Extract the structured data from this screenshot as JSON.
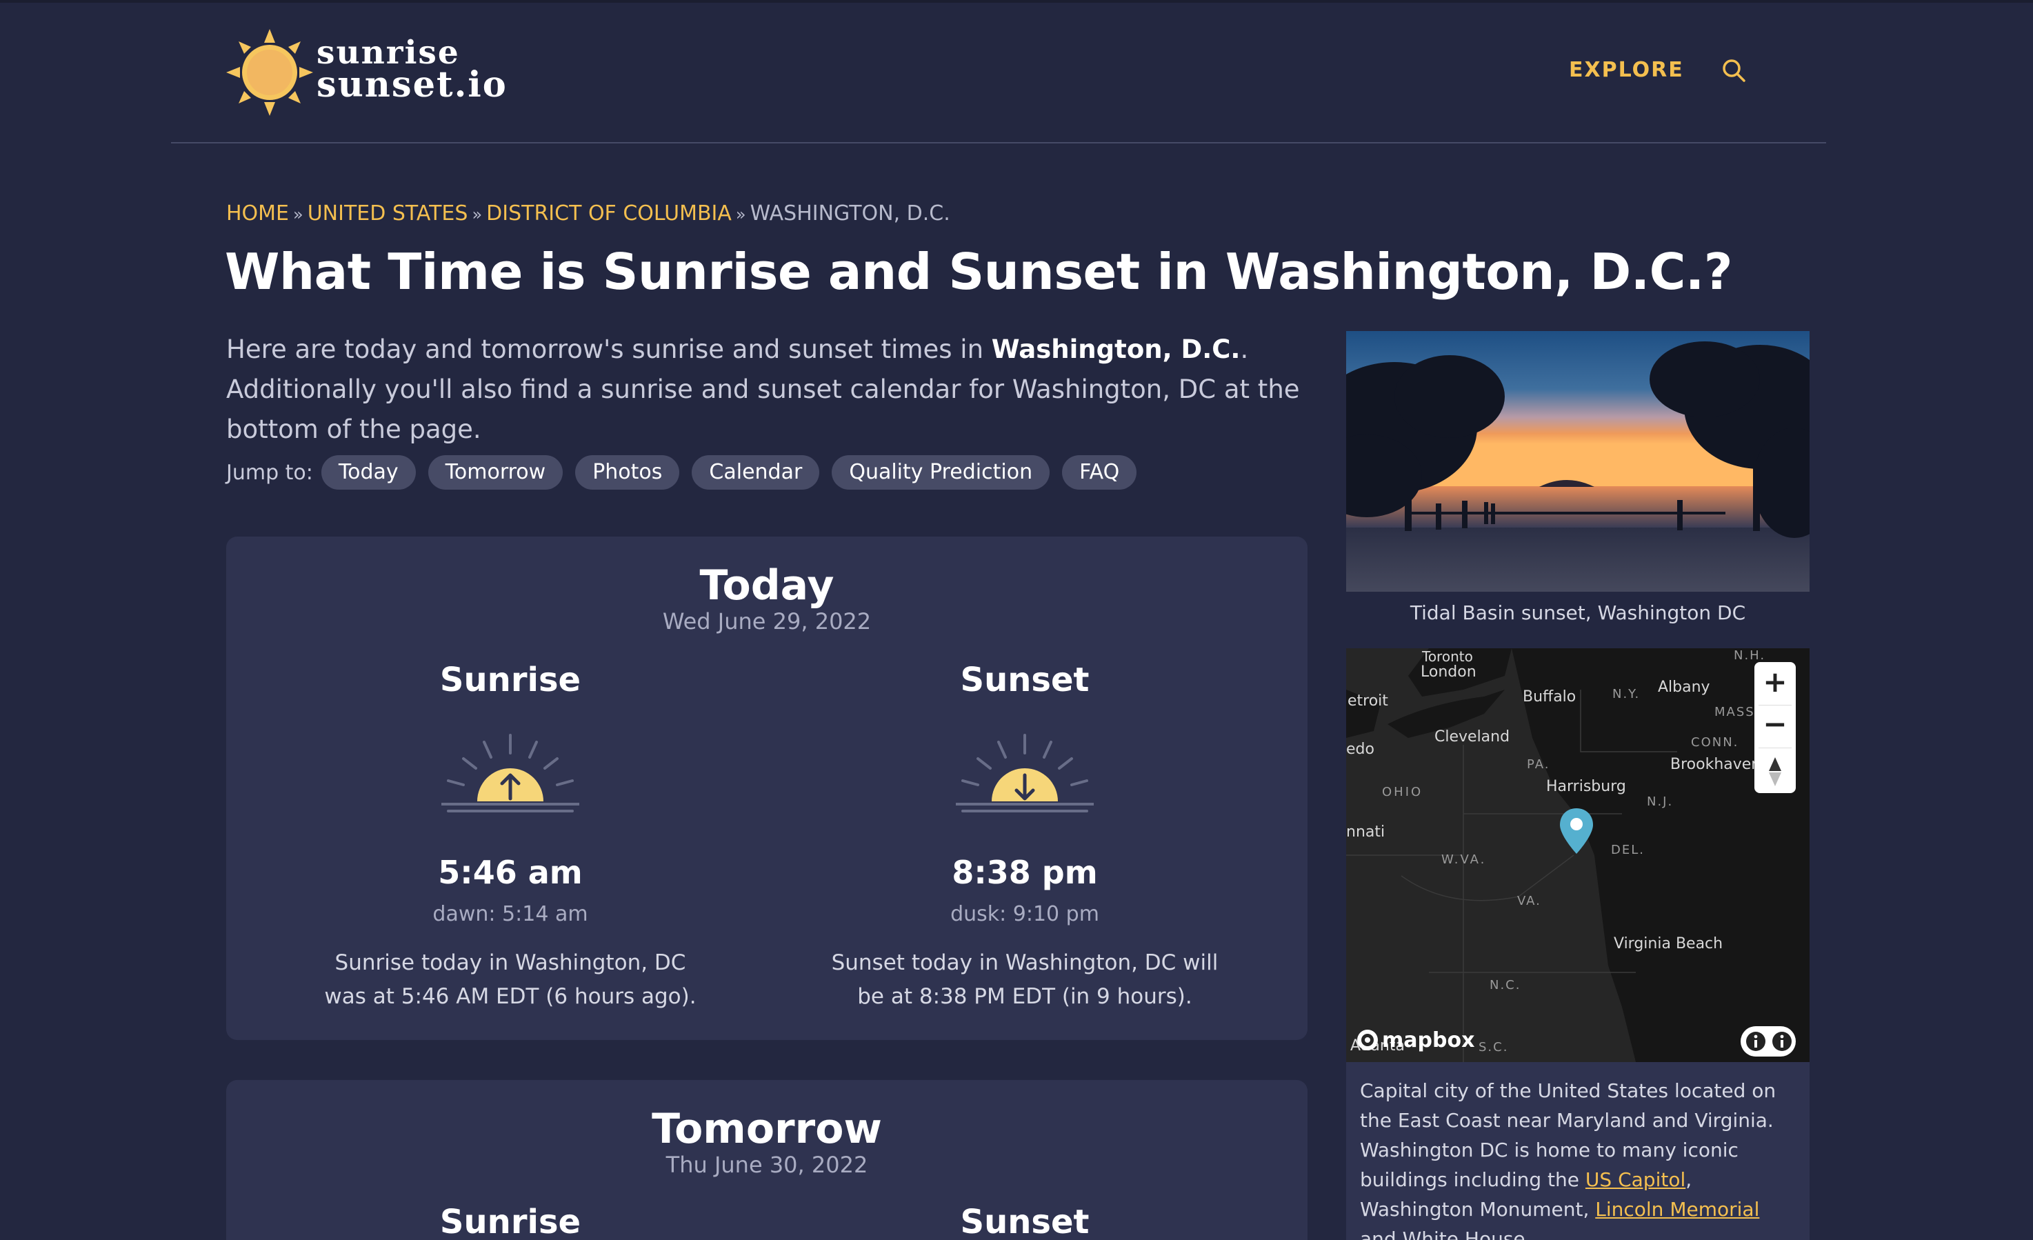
{
  "header": {
    "logo_line1": "sunrise",
    "logo_line2": "sunset.io",
    "explore": "EXPLORE"
  },
  "breadcrumb": [
    "HOME",
    "UNITED STATES",
    "DISTRICT OF COLUMBIA",
    "WASHINGTON, D.C."
  ],
  "breadcrumb_sep": "»",
  "page_title": "What Time is Sunrise and Sunset in Washington, D.C.?",
  "intro": {
    "part1": "Here are today and tomorrow's sunrise and sunset times in ",
    "bold": "Washington, D.C.",
    "part2": ". Additionally you'll also find a sunrise and sunset calendar for Washington, DC at the bottom of the page."
  },
  "jump": {
    "label": "Jump to:",
    "items": [
      "Today",
      "Tomorrow",
      "Photos",
      "Calendar",
      "Quality Prediction",
      "FAQ"
    ]
  },
  "today": {
    "title": "Today",
    "date": "Wed June 29, 2022",
    "sunrise": {
      "label": "Sunrise",
      "time": "5:46 am",
      "sub": "dawn: 5:14 am",
      "desc": "Sunrise today in Washington, DC was at 5:46 AM EDT (6 hours ago)."
    },
    "sunset": {
      "label": "Sunset",
      "time": "8:38 pm",
      "sub": "dusk: 9:10 pm",
      "desc": "Sunset today in Washington, DC will be at 8:38 PM EDT (in 9 hours)."
    }
  },
  "tomorrow": {
    "title": "Tomorrow",
    "date": "Thu June 30, 2022",
    "sunrise_label": "Sunrise",
    "sunset_label": "Sunset"
  },
  "sidebar": {
    "photo_caption": "Tidal Basin sunset, Washington DC",
    "map": {
      "labels": [
        "Toronto",
        "London",
        "etroit",
        "Buffalo",
        "N.Y.",
        "Albany",
        "MASS.",
        "edo",
        "Cleveland",
        "CONN.",
        "PA.",
        "Brookhaven",
        "OHIO",
        "Harrisburg",
        "N.J.",
        "nnati",
        "DEL.",
        "W.VA.",
        "VA.",
        "Virginia Beach",
        "N.C.",
        "N.H.",
        "Atlanta",
        "S.C."
      ],
      "zoom_in": "+",
      "zoom_out": "−",
      "attribution": "mapbox"
    },
    "info": {
      "part1": "Capital city of the United States located on the East Coast near Maryland and Virginia. Washington DC is home to many iconic buildings including the ",
      "link1": "US Capitol",
      "part2": ", Washington Monument, ",
      "link2": "Lincoln Memorial",
      "part3": " and White House."
    }
  },
  "colors": {
    "background": "#232740",
    "card": "#2f3350",
    "accent": "#f4bf4f",
    "sun": "#f6d679"
  }
}
